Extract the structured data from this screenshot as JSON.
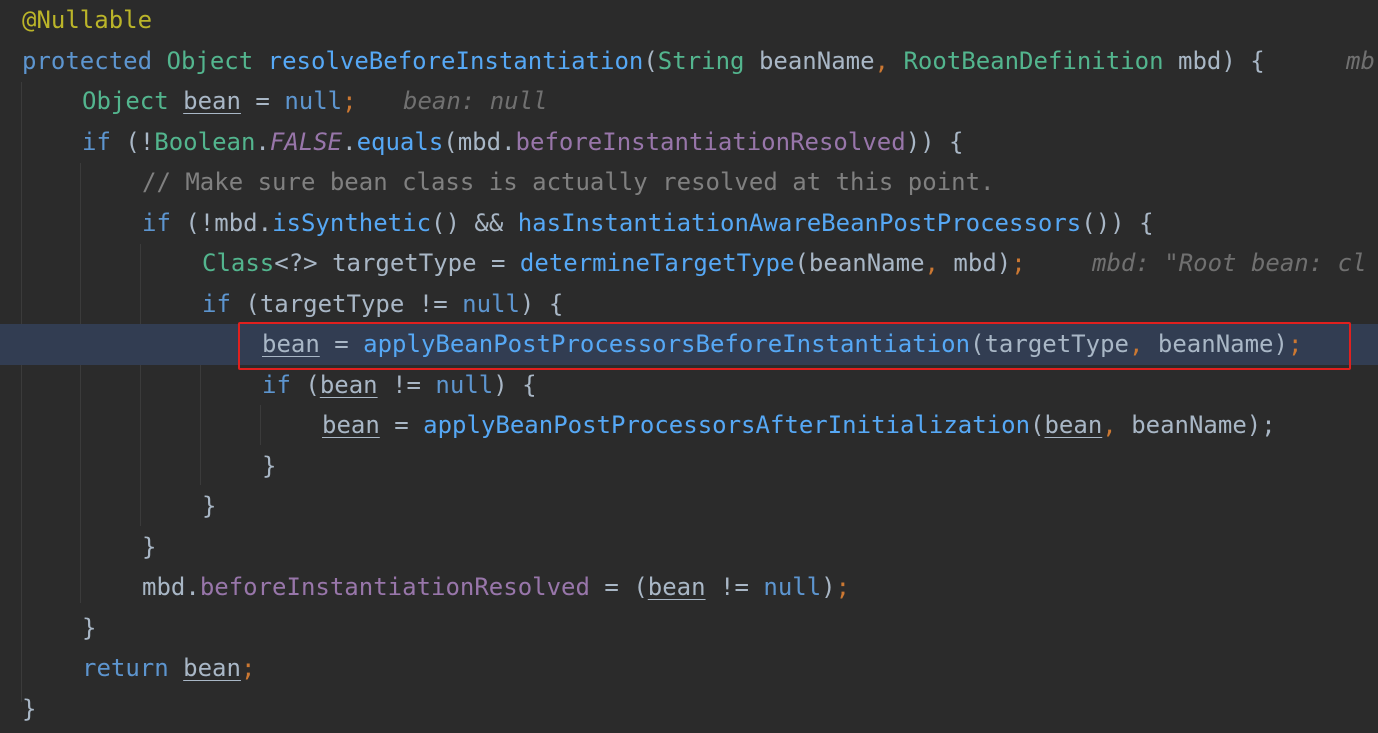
{
  "editor": {
    "language": "Java",
    "colors": {
      "background": "#2b2b2b",
      "current_line": "#323d52",
      "keyword": "#5d95cf",
      "type": "#53b58e",
      "annotation": "#bbb529",
      "method": "#56a8f5",
      "field": "#9876aa",
      "comment": "#808080",
      "highlight_border": "#e0201e"
    },
    "l1": {
      "annotation": "@Nullable"
    },
    "l2": {
      "modifier": "protected",
      "return_type": "Object",
      "method": "resolveBeforeInstantiation",
      "p1_type": "String",
      "p1_name": "beanName",
      "p2_type": "RootBeanDefinition",
      "p2_name": "mbd",
      "brace": "{",
      "hint": "mb"
    },
    "l3": {
      "type": "Object",
      "var": "bean",
      "assign": "=",
      "value": "null",
      "semi": ";",
      "hint": "bean: null"
    },
    "l4": {
      "kw": "if",
      "open": "(!",
      "cls": "Boolean",
      "dot1": ".",
      "const": "FALSE",
      "dot2": ".",
      "method": "equals",
      "p_open": "(",
      "obj": "mbd",
      "dot3": ".",
      "field": "beforeInstantiationResolved",
      "close": ")) {"
    },
    "l5": {
      "comment": "// Make sure bean class is actually resolved at this point."
    },
    "l6": {
      "kw": "if",
      "open": "(!",
      "obj": "mbd",
      "dot": ".",
      "method1": "isSynthetic",
      "mid": "() && ",
      "method2": "hasInstantiationAwareBeanPostProcessors",
      "close": "()) {"
    },
    "l7": {
      "type": "Class",
      "generic": "<?>",
      "var": "targetType",
      "assign": "=",
      "method": "determineTargetType",
      "args_open": "(",
      "a1": "beanName",
      "comma": ",",
      "a2": "mbd",
      "args_close": ")",
      "semi": ";",
      "hint": "mbd: \"Root bean: cl"
    },
    "l8": {
      "kw": "if",
      "open": "(",
      "var": "targetType",
      "op": "!=",
      "value": "null",
      "close": ") {"
    },
    "l9": {
      "var": "bean",
      "assign": "=",
      "method": "applyBeanPostProcessorsBeforeInstantiation",
      "args_open": "(",
      "a1": "targetType",
      "comma": ",",
      "a2": "beanName",
      "args_close": ")",
      "semi": ";"
    },
    "l10": {
      "kw": "if",
      "open": "(",
      "var": "bean",
      "op": "!=",
      "value": "null",
      "close": ") {"
    },
    "l11": {
      "var": "bean",
      "assign": "=",
      "method": "applyBeanPostProcessorsAfterInitialization",
      "args_open": "(",
      "a1": "bean",
      "comma": ",",
      "a2": "beanName",
      "args_close": ");"
    },
    "l12": {
      "brace": "}"
    },
    "l13": {
      "brace": "}"
    },
    "l14": {
      "brace": "}"
    },
    "l15": {
      "obj": "mbd",
      "dot": ".",
      "field": "beforeInstantiationResolved",
      "assign": "=",
      "open": "(",
      "var": "bean",
      "op": "!=",
      "value": "null",
      "close": ")",
      "semi": ";"
    },
    "l16": {
      "brace": "}"
    },
    "l17": {
      "kw": "return",
      "var": "bean",
      "semi": ";"
    },
    "l18": {
      "brace": "}"
    }
  }
}
